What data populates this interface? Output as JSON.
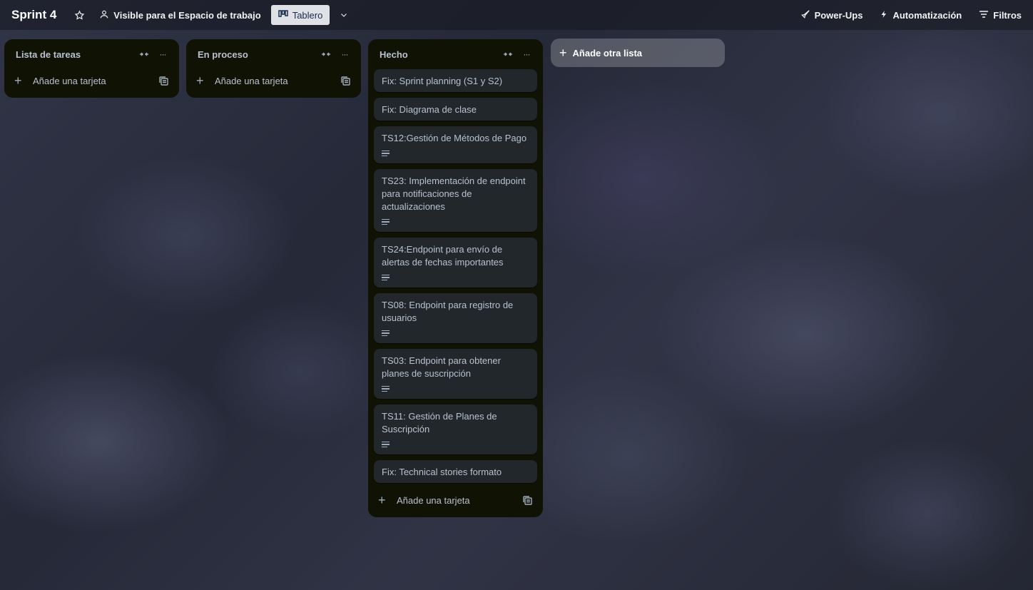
{
  "board": {
    "title": "Sprint 4",
    "visibility_label": "Visible para el Espacio de trabajo",
    "view_label": "Tablero",
    "powerups_label": "Power-Ups",
    "automation_label": "Automatización",
    "filters_label": "Filtros"
  },
  "lists": [
    {
      "title": "Lista de tareas",
      "add_card_label": "Añade una tarjeta",
      "cards": []
    },
    {
      "title": "En proceso",
      "add_card_label": "Añade una tarjeta",
      "cards": []
    },
    {
      "title": "Hecho",
      "add_card_label": "Añade una tarjeta",
      "cards": [
        {
          "title": "Fix: Sprint planning (S1 y S2)",
          "has_description": false
        },
        {
          "title": "Fix: Diagrama de clase",
          "has_description": false
        },
        {
          "title": "TS12:Gestión de Métodos de Pago",
          "has_description": true
        },
        {
          "title": "TS23: Implementación de endpoint para notificaciones de actualizaciones",
          "has_description": true
        },
        {
          "title": "TS24:Endpoint para envío de alertas de fechas importantes",
          "has_description": true
        },
        {
          "title": "TS08: Endpoint para registro de usuarios",
          "has_description": true
        },
        {
          "title": "TS03: Endpoint para obtener planes de suscripción",
          "has_description": true
        },
        {
          "title": "TS11: Gestión de Planes de Suscripción",
          "has_description": true
        },
        {
          "title": "Fix: Technical stories formato",
          "has_description": false
        }
      ]
    }
  ],
  "add_list_label": "Añade otra lista",
  "icons": {
    "star": "star-icon",
    "visibility": "people-icon",
    "view": "board-icon",
    "view_switcher": "chevron-down-icon",
    "powerups": "rocket-icon",
    "automation": "lightning-icon",
    "filters": "filter-icon",
    "collapse": "collapse-list-icon",
    "more": "more-icon",
    "add": "plus-icon",
    "template": "card-template-icon",
    "description": "description-icon"
  },
  "colors": {
    "list_bg": "#101204",
    "card_bg": "#22272b",
    "text": "#b6c2cf",
    "view_button_bg": "#dfe1e6"
  }
}
